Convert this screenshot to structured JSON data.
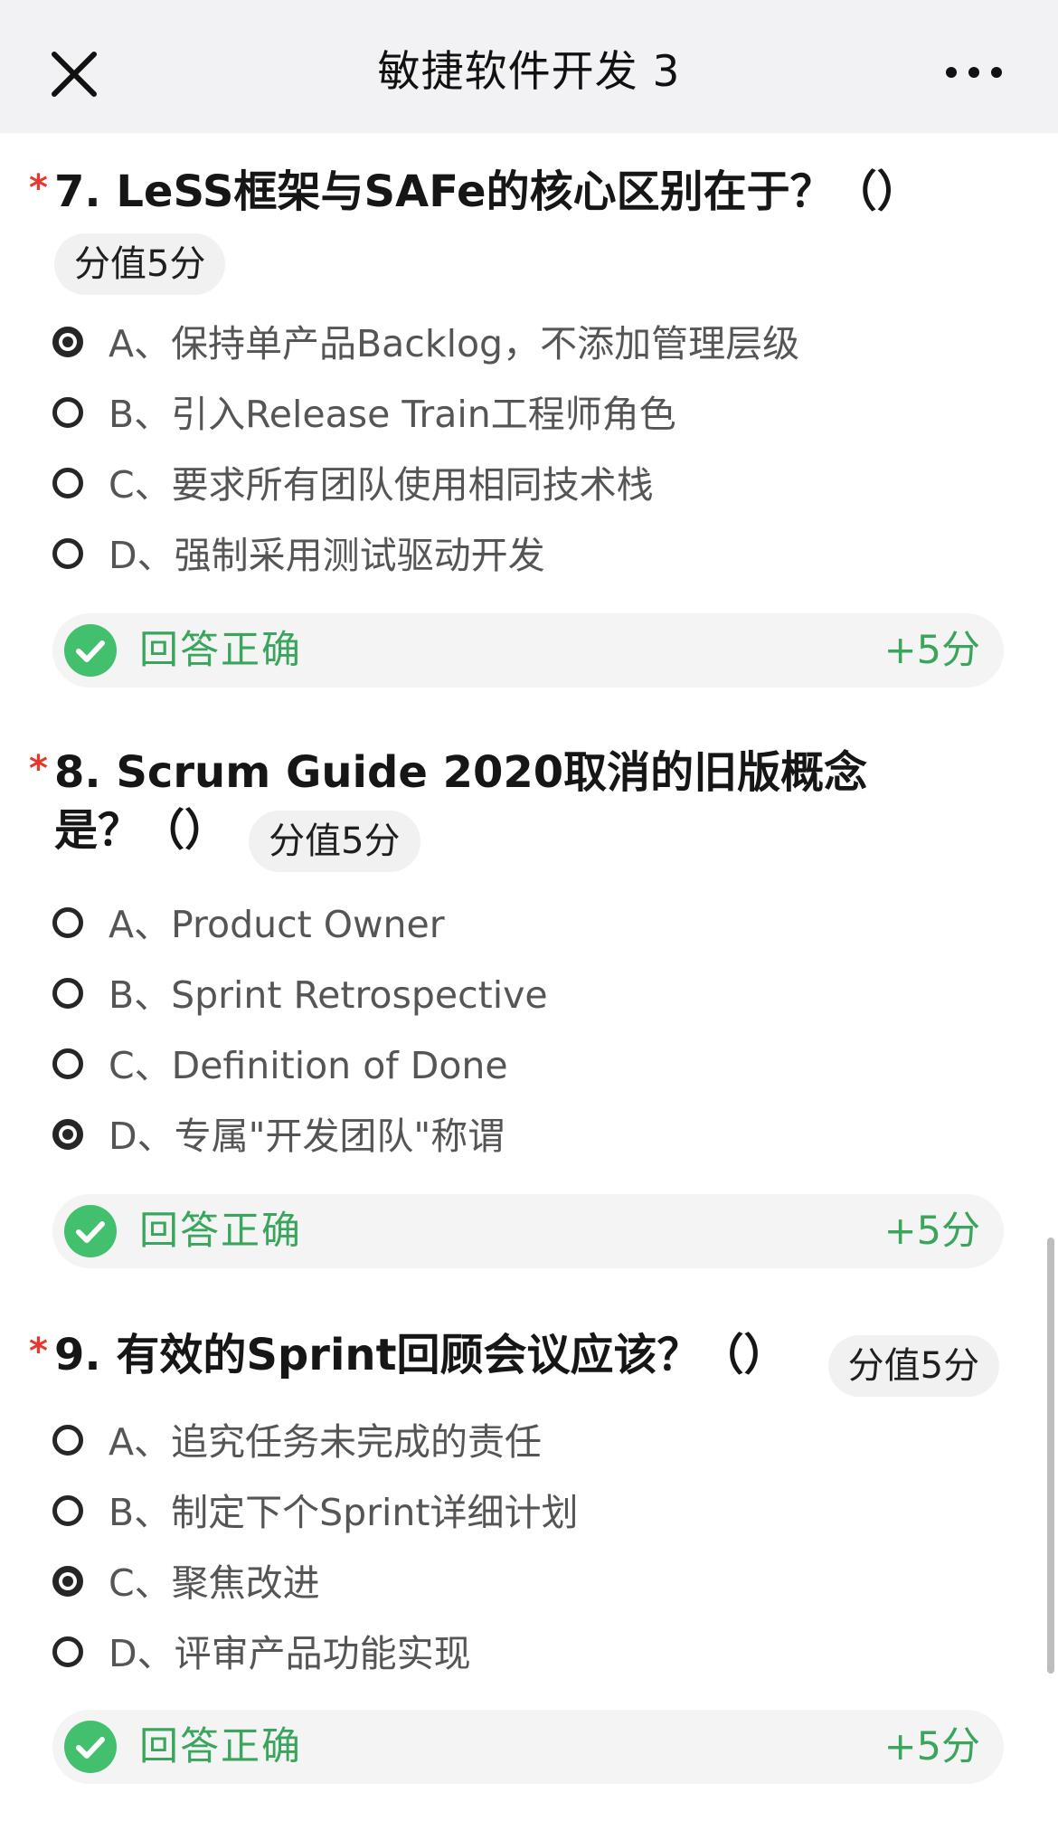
{
  "header": {
    "title": "敏捷软件开发 3"
  },
  "questions": [
    {
      "required_mark": "*",
      "text": "7. LeSS框架与SAFe的核心区别在于？（）",
      "score_badge": "分值5分",
      "options": [
        {
          "label": "A、保持单产品Backlog，不添加管理层级",
          "selected": true
        },
        {
          "label": "B、引入Release Train工程师角色",
          "selected": false
        },
        {
          "label": "C、要求所有团队使用相同技术栈",
          "selected": false
        },
        {
          "label": "D、强制采用测试驱动开发",
          "selected": false
        }
      ],
      "result": {
        "text": "回答正确",
        "score": "+5分"
      }
    },
    {
      "required_mark": "*",
      "text": "8. Scrum Guide 2020取消的旧版概念是？（）",
      "score_badge": "分值5分",
      "options": [
        {
          "label": "A、Product Owner",
          "selected": false
        },
        {
          "label": "B、Sprint Retrospective",
          "selected": false
        },
        {
          "label": "C、Definition of Done",
          "selected": false
        },
        {
          "label": "D、专属\"开发团队\"称谓",
          "selected": true
        }
      ],
      "result": {
        "text": "回答正确",
        "score": "+5分"
      }
    },
    {
      "required_mark": "*",
      "text": "9. 有效的Sprint回顾会议应该？（）",
      "score_badge": "分值5分",
      "options": [
        {
          "label": "A、追究任务未完成的责任",
          "selected": false
        },
        {
          "label": "B、制定下个Sprint详细计划",
          "selected": false
        },
        {
          "label": "C、聚焦改进",
          "selected": true
        },
        {
          "label": "D、评审产品功能实现",
          "selected": false
        }
      ],
      "result": {
        "text": "回答正确",
        "score": "+5分"
      }
    }
  ],
  "colors": {
    "topbar_bg": "#f2f2f4",
    "required": "#e8372b",
    "correct": "#3aa55c",
    "badge_bg": "#f1f1f1"
  },
  "icons": {
    "close": "close-icon",
    "more": "more-dots-icon",
    "check": "check-circle-icon"
  }
}
